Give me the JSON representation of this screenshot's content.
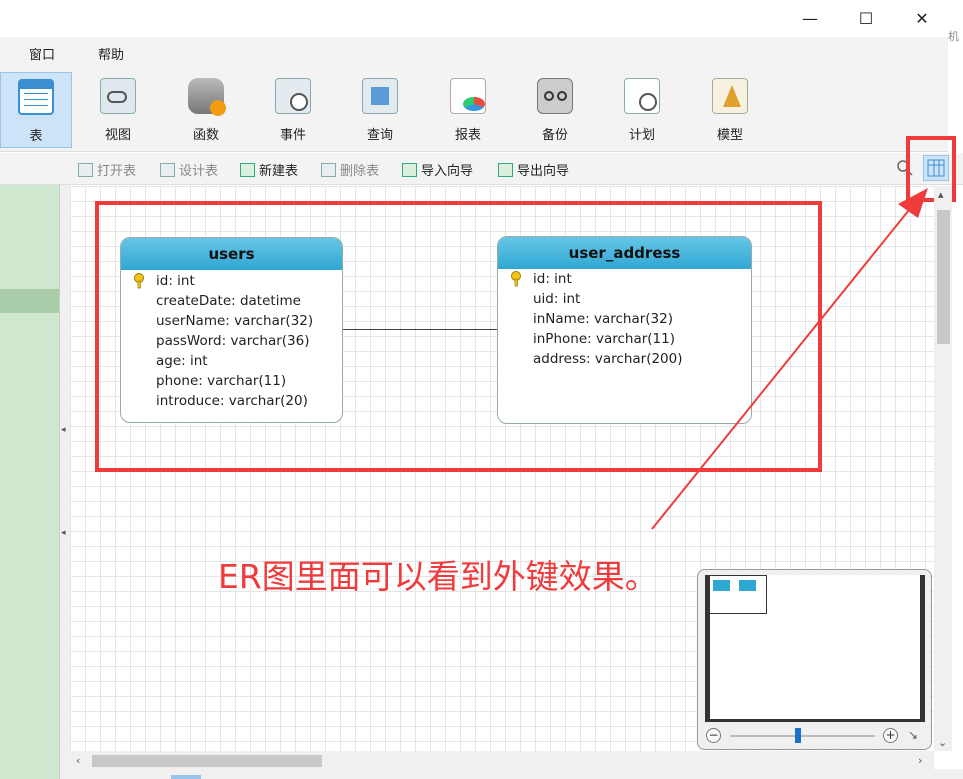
{
  "window": {
    "minimize": "—",
    "maximize": "☐",
    "close": "✕",
    "edge_fragment": "机"
  },
  "menu": [
    "窗口",
    "帮助"
  ],
  "ribbon": [
    {
      "label": "表",
      "icon": "table-icon",
      "active": true
    },
    {
      "label": "视图",
      "icon": "view-icon"
    },
    {
      "label": "函数",
      "icon": "function-icon"
    },
    {
      "label": "事件",
      "icon": "event-icon"
    },
    {
      "label": "查询",
      "icon": "query-icon"
    },
    {
      "label": "报表",
      "icon": "report-icon"
    },
    {
      "label": "备份",
      "icon": "backup-icon"
    },
    {
      "label": "计划",
      "icon": "schedule-icon"
    },
    {
      "label": "模型",
      "icon": "model-icon"
    }
  ],
  "subtoolbar": [
    {
      "label": "打开表",
      "enabled": false
    },
    {
      "label": "设计表",
      "enabled": false
    },
    {
      "label": "新建表",
      "enabled": true
    },
    {
      "label": "删除表",
      "enabled": false
    },
    {
      "label": "导入向导",
      "enabled": true
    },
    {
      "label": "导出向导",
      "enabled": true
    }
  ],
  "er": {
    "users": {
      "title": "users",
      "fields": [
        "id: int",
        "createDate: datetime",
        "userName: varchar(32)",
        "passWord: varchar(36)",
        "age: int",
        "phone: varchar(11)",
        "introduce: varchar(20)"
      ]
    },
    "user_address": {
      "title": "user_address",
      "fields": [
        "id: int",
        "uid: int",
        "inName: varchar(32)",
        "inPhone: varchar(11)",
        "address: varchar(200)"
      ]
    }
  },
  "annotation": "ER图里面可以看到外键效果。",
  "minimap": {
    "zoom_out": "−",
    "zoom_in": "+",
    "fit": "↘"
  },
  "colors": {
    "annotation": "#ef3b3b",
    "entity_header": "#2fa7d3",
    "left_panel": "#cfe6cf"
  }
}
